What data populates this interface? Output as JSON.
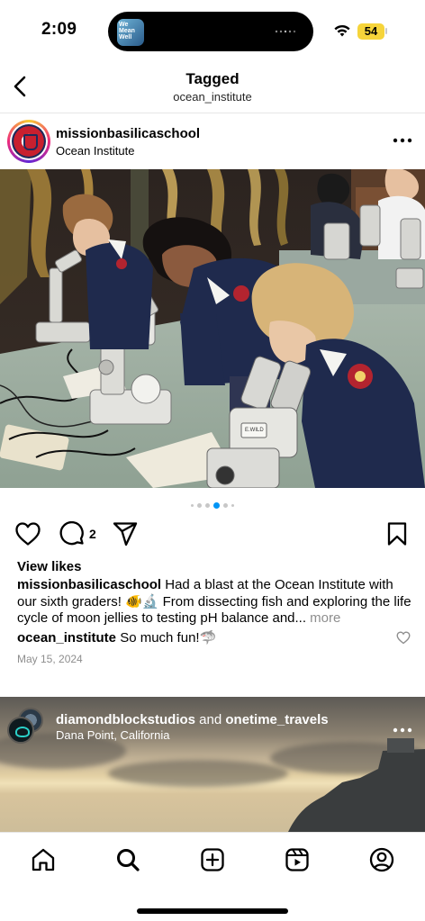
{
  "status_bar": {
    "time": "2:09",
    "battery": "54",
    "island_thumb_text": "We Mean Well"
  },
  "header": {
    "title": "Tagged",
    "subtitle": "ocean_institute"
  },
  "post": {
    "username": "missionbasilicaschool",
    "location": "Ocean Institute",
    "carousel": {
      "count": 6,
      "active_index": 3
    },
    "comment_count": "2",
    "view_likes_label": "View likes",
    "caption_user": "missionbasilicaschool",
    "caption_text": " Had a blast at the Ocean Institute with our sixth graders! 🐠🔬  From dissecting fish and exploring the life cycle of moon jellies to testing pH balance and...",
    "caption_more": " more",
    "comment_user": "ocean_institute",
    "comment_text": " So much fun!🦈",
    "date": "May 15, 2024",
    "microscope_label": "E.WILD\nFERN"
  },
  "next_post": {
    "user_a": "diamondblockstudios",
    "joiner": " and ",
    "user_b": "onetime_travels",
    "location": "Dana Point, California"
  },
  "colors": {
    "accent_blue": "#0095f6",
    "battery_yellow": "#f6d43a",
    "muted_text": "#8e8e8e"
  },
  "icons": {
    "back": "chevron-left-icon",
    "more": "more-horizontal-icon",
    "like": "heart-icon",
    "comment": "comment-icon",
    "share": "paper-plane-icon",
    "save": "bookmark-icon",
    "nav": [
      "home-icon",
      "search-icon",
      "create-icon",
      "reels-icon",
      "profile-icon"
    ]
  }
}
